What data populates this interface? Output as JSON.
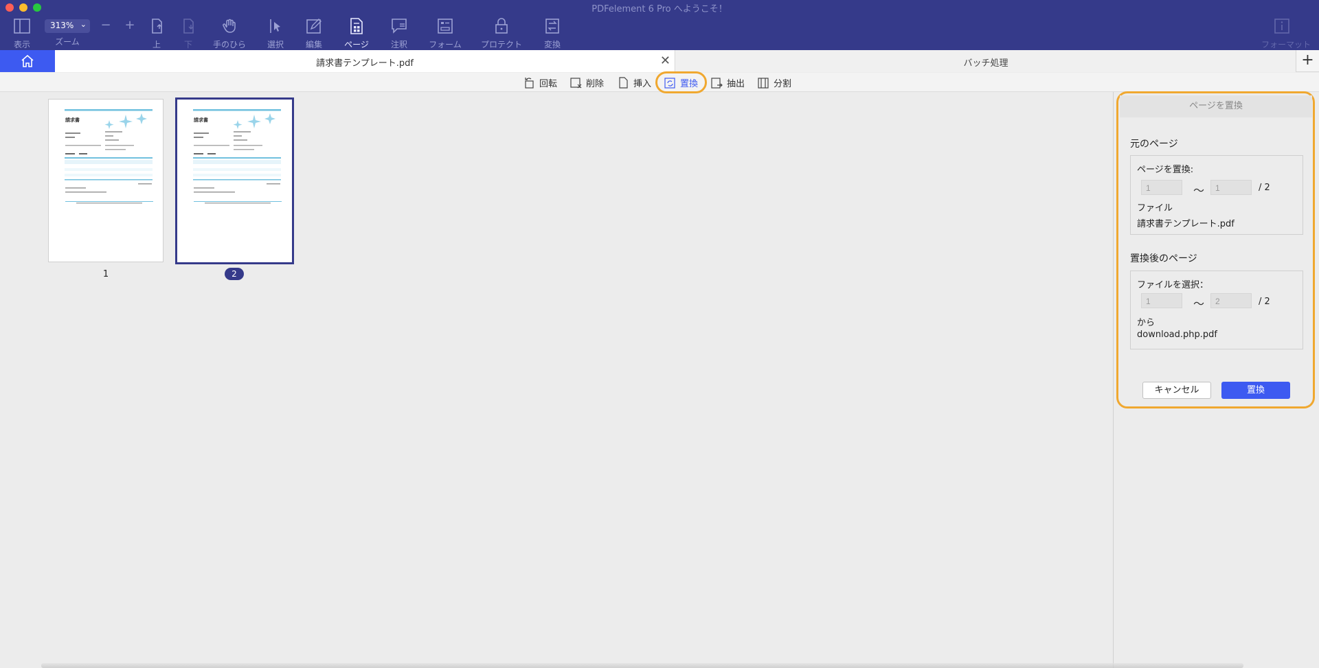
{
  "window": {
    "title": "PDFelement 6 Pro へようこそ！"
  },
  "toolbar": {
    "zoom_value": "313%",
    "zoom_label": "ズーム",
    "items": [
      {
        "label": "表示",
        "icon": "sidebar-icon"
      },
      {
        "label": "上",
        "icon": "page-up-icon"
      },
      {
        "label": "下",
        "icon": "page-down-icon"
      },
      {
        "label": "手のひら",
        "icon": "hand-icon"
      },
      {
        "label": "選択",
        "icon": "select-cursor-icon"
      },
      {
        "label": "編集",
        "icon": "edit-icon"
      },
      {
        "label": "ページ",
        "icon": "page-icon"
      },
      {
        "label": "注釈",
        "icon": "comment-icon"
      },
      {
        "label": "フォーム",
        "icon": "form-icon"
      },
      {
        "label": "プロテクト",
        "icon": "lock-icon"
      },
      {
        "label": "変換",
        "icon": "convert-icon"
      },
      {
        "label": "フォーマット",
        "icon": "info-icon"
      }
    ],
    "zoom_out": "−",
    "zoom_in": "+"
  },
  "tabs": {
    "document": "請求書テンプレート.pdf",
    "batch": "バッチ処理",
    "add": "+"
  },
  "page_tools": [
    {
      "label": "回転",
      "icon": "rotate-icon"
    },
    {
      "label": "削除",
      "icon": "delete-page-icon"
    },
    {
      "label": "挿入",
      "icon": "insert-page-icon"
    },
    {
      "label": "置換",
      "icon": "replace-page-icon"
    },
    {
      "label": "抽出",
      "icon": "extract-page-icon"
    },
    {
      "label": "分割",
      "icon": "split-page-icon"
    }
  ],
  "pages": [
    {
      "number": "1",
      "selected": false,
      "doc_title": "請求書"
    },
    {
      "number": "2",
      "selected": true,
      "doc_title": "請求書"
    }
  ],
  "panel": {
    "title": "ページを置換",
    "original": {
      "section_title": "元のページ",
      "replace_label": "ページを置換:",
      "from_value": "1",
      "to_value": "1",
      "tilde": "〜",
      "total": "/ 2",
      "file_label": "ファイル",
      "file_name": "請求書テンプレート.pdf"
    },
    "replacement": {
      "section_title": "置換後のページ",
      "select_label": "ファイルを選択：",
      "from_value": "1",
      "to_value": "2",
      "tilde": "〜",
      "total": "/ 2",
      "from_label": "から",
      "file_name": "download.php.pdf"
    },
    "cancel": "キャンセル",
    "replace": "置換"
  },
  "colors": {
    "toolbar_bg": "#353a8a",
    "accent": "#3d5af1",
    "highlight": "#f0a830"
  }
}
